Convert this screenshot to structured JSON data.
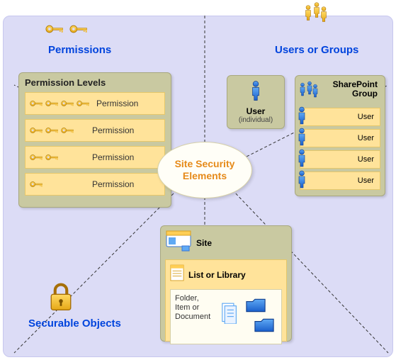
{
  "center": {
    "label": "Site Security\nElements"
  },
  "permissions": {
    "heading": "Permissions",
    "panel_title": "Permission Levels",
    "rows": [
      {
        "label": "Permission",
        "key_count": 4
      },
      {
        "label": "Permission",
        "key_count": 3
      },
      {
        "label": "Permission",
        "key_count": 2
      },
      {
        "label": "Permission",
        "key_count": 1
      }
    ]
  },
  "users": {
    "heading": "Users or Groups",
    "single": {
      "label": "User",
      "sublabel": "(individual)"
    },
    "group": {
      "title": "SharePoint\nGroup",
      "rows": [
        {
          "label": "User"
        },
        {
          "label": "User"
        },
        {
          "label": "User"
        },
        {
          "label": "User"
        }
      ]
    }
  },
  "securable": {
    "heading": "Securable Objects",
    "site_label": "Site",
    "list_label": "List or Library",
    "folder_label": "Folder,\nItem or\nDocument"
  },
  "icons": {
    "key": "key-icon",
    "person": "person-icon",
    "people_group": "people-group-icon",
    "lock": "lock-icon",
    "site": "site-icon",
    "list": "list-icon",
    "document": "document-icon",
    "folder": "folder-icon"
  },
  "chart_data": {
    "type": "diagram",
    "title": "Site Security Elements",
    "nodes": [
      {
        "id": "center",
        "label": "Site Security Elements"
      },
      {
        "id": "permissions",
        "label": "Permissions",
        "children": [
          "Permission Levels"
        ]
      },
      {
        "id": "users_groups",
        "label": "Users or Groups",
        "children": [
          "User (individual)",
          "SharePoint Group"
        ]
      },
      {
        "id": "securable",
        "label": "Securable Objects",
        "children": [
          "Site",
          "List or Library",
          "Folder, Item or Document"
        ]
      }
    ],
    "edges": [
      {
        "from": "center",
        "to": "permissions"
      },
      {
        "from": "center",
        "to": "users_groups"
      },
      {
        "from": "center",
        "to": "securable"
      }
    ]
  }
}
